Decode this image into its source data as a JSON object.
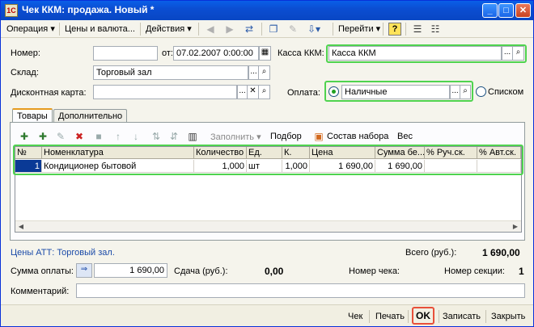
{
  "window": {
    "title": "Чек ККМ: продажа. Новый *"
  },
  "toolbar": {
    "operation": "Операция",
    "prices": "Цены и валюта...",
    "actions": "Действия",
    "goto": "Перейти",
    "help": "?"
  },
  "form": {
    "number_label": "Номер:",
    "number_value": "",
    "from_label": "от:",
    "date_value": "07.02.2007  0:00:00",
    "kassa_label": "Касса ККМ:",
    "kassa_value": "Касса ККМ",
    "warehouse_label": "Склад:",
    "warehouse_value": "Торговый зал",
    "card_label": "Дисконтная карта:",
    "card_value": "",
    "payment_label": "Оплата:",
    "payment_value": "Наличные",
    "list_label": "Списком"
  },
  "tabs": [
    {
      "label": "Товары"
    },
    {
      "label": "Дополнительно"
    }
  ],
  "table_toolbar": {
    "fill": "Заполнить",
    "selection": "Подбор",
    "kit": "Состав набора",
    "weight": "Вес"
  },
  "table": {
    "columns": [
      "№",
      "Номенклатура",
      "Количество",
      "Ед.",
      "К.",
      "Цена",
      "Сумма бе...",
      "% Руч.ск.",
      "% Авт.ск."
    ],
    "rows": [
      [
        "1",
        "Кондиционер бытовой",
        "1,000",
        "шт",
        "1,000",
        "1 690,00",
        "1 690,00",
        "",
        ""
      ]
    ]
  },
  "summary": {
    "prices_type": "Цены АТТ: Торговый зал.",
    "total_label": "Всего (руб.):",
    "total_value": "1 690,00",
    "pay_sum_label": "Сумма оплаты:",
    "pay_sum_value": "1 690,00",
    "change_label": "Сдача (руб.):",
    "change_value": "0,00",
    "check_no_label": "Номер чека:",
    "check_no_value": "",
    "section_label": "Номер секции:",
    "section_value": "1",
    "comment_label": "Комментарий:",
    "comment_value": ""
  },
  "bottom": {
    "check": "Чек",
    "print": "Печать",
    "ok": "OK",
    "save": "Записать",
    "close": "Закрыть"
  },
  "colors": {
    "highlight_green": "#4fd34f",
    "highlight_red": "#e8503a",
    "title_blue": "#0b4ed2"
  }
}
